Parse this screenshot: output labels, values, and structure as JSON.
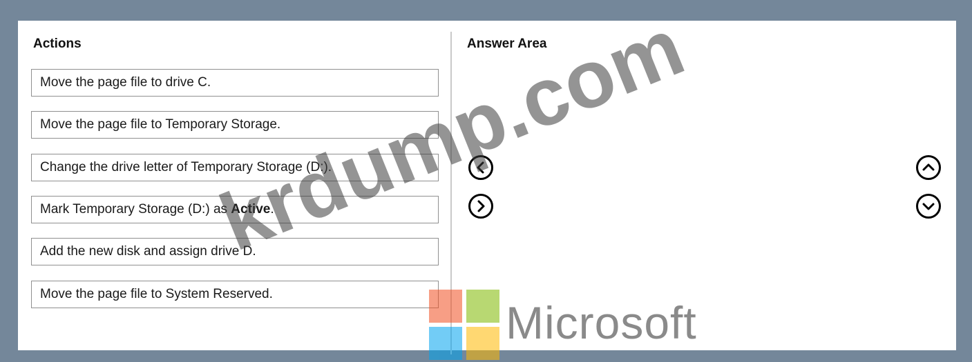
{
  "actions_title": "Actions",
  "answer_title": "Answer Area",
  "actions": [
    {
      "text": "Move the page file to drive C.",
      "bold": ""
    },
    {
      "text": "Move the page file to Temporary Storage.",
      "bold": ""
    },
    {
      "text": "Change the drive letter of Temporary Storage (D:).",
      "bold": ""
    },
    {
      "text": "Mark Temporary Storage (D:) as ",
      "bold": "Active",
      "suffix": "."
    },
    {
      "text": "Add the new disk and assign drive D.",
      "bold": ""
    },
    {
      "text": "Move the page file to System Reserved.",
      "bold": ""
    }
  ],
  "buttons": {
    "move_left": "left-arrow-icon",
    "move_right": "right-arrow-icon",
    "move_up": "up-arrow-icon",
    "move_down": "down-arrow-icon"
  },
  "watermark": {
    "text": "krdump.com",
    "brand": "Microsoft"
  },
  "colors": {
    "frame": "#74879a",
    "logo_red": "#f25022",
    "logo_green": "#7fba00",
    "logo_blue": "#00a4ef",
    "logo_yellow": "#ffb900"
  }
}
